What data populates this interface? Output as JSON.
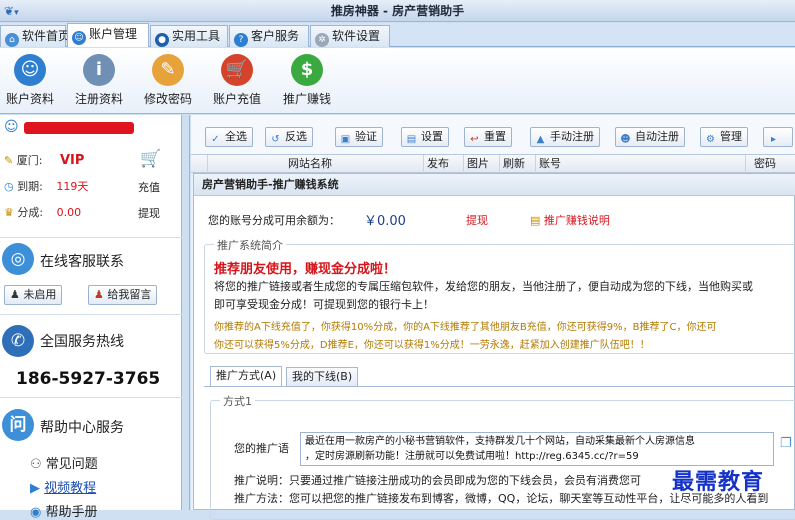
{
  "window": {
    "title": "推房神器 - 房产营销助手",
    "sys_icon": "▾"
  },
  "tabs": [
    {
      "label": "软件首页",
      "icon": "home-icon"
    },
    {
      "label": "账户管理",
      "icon": "user-icon"
    },
    {
      "label": "实用工具",
      "icon": "tools-icon"
    },
    {
      "label": "客户服务",
      "icon": "help-icon"
    },
    {
      "label": "软件设置",
      "icon": "gear-icon"
    }
  ],
  "ribbon": [
    {
      "label": "账户资料",
      "icon": "user-profile-icon",
      "color": "#2f7fd0"
    },
    {
      "label": "注册资料",
      "icon": "info-user-icon",
      "color": "#6f8fb5"
    },
    {
      "label": "修改密码",
      "icon": "pencil-paper-icon",
      "color": "#e8a23a"
    },
    {
      "label": "账户充值",
      "icon": "cart-icon",
      "color": "#d6432b"
    },
    {
      "label": "推广赚钱",
      "icon": "dollar-icon",
      "color": "#3aa93f"
    }
  ],
  "account": {
    "level_label": "厦门:",
    "level_value": "VIP",
    "expire_label": "到期:",
    "expire_value": "119天",
    "share_label": "分成:",
    "share_value": "0.00",
    "recharge_label": "充值",
    "withdraw_label": "提现"
  },
  "support": {
    "online_title": "在线客服联系",
    "not_enabled": "未启用",
    "leave_message": "给我留言",
    "hotline_title": "全国服务热线",
    "hotline": "186-5927-3765",
    "help_title": "帮助中心服务",
    "faq": "常见问题",
    "video": "视频教程",
    "manual": "帮助手册"
  },
  "toolbar": [
    {
      "label": "全选",
      "g": "✓"
    },
    {
      "label": "反选",
      "g": "↺"
    },
    {
      "label": "验证",
      "g": "▣"
    },
    {
      "label": "设置",
      "g": "▤"
    },
    {
      "label": "重置",
      "g": "↩"
    },
    {
      "label": "手动注册",
      "g": "▲"
    },
    {
      "label": "自动注册",
      "g": "☻"
    },
    {
      "label": "管理",
      "g": "⚙"
    }
  ],
  "grid_headers": [
    "网站名称",
    "发布",
    "图片",
    "刷新",
    "账号",
    "密码"
  ],
  "panel": {
    "title": "房产营销助手-推广赚钱系统",
    "balance_label": "您的账号分成可用余额为：",
    "balance_value": "￥0.00",
    "withdraw": "提现",
    "explain_link": "推广赚钱说明",
    "intro_legend": "推广系统简介",
    "headline": "推荐朋友使用，赚现金分成啦！",
    "intro_line1": "将您的推广链接或者生成您的专属压缩包软件，发给您的朋友，当他注册了，便自动成为您的下线，当他购买或",
    "intro_line2": "即可享受现金分成！可提现到您的银行卡上！",
    "orange_line1": "你推荐的A下线充值了，你获得10%分成，你的A下线推荐了其他朋友B充值，你还可获得9%，B推荐了C，你还可",
    "orange_line2": "你还可以获得5%分成，D推荐E，你还可以获得1%分成！一劳永逸，赶紧加入创建推广队伍吧！！",
    "tab_active": "推广方式(A)",
    "tab_other": "我的下线(B)",
    "method_legend": "方式1",
    "slogan_label": "您的推广语",
    "slogan_line1": "最近在用一款房产的小秘书营销软件，支持群发几十个网站，自动采集最新个人房源信息",
    "slogan_line2": "，定时房源刷新功能！注册就可以免费试用啦！http://reg.6345.cc/?r=59",
    "desc_line": "推广说明：只要通过推广链接注册成功的会员即成为您的下线会员，会员有消费您可",
    "method_line": "推广方法：您可以把您的推广链接发布到博客，微博，QQ，论坛，聊天室等互动性平台，让尽可能多的人看到"
  },
  "watermark": "最需教育"
}
